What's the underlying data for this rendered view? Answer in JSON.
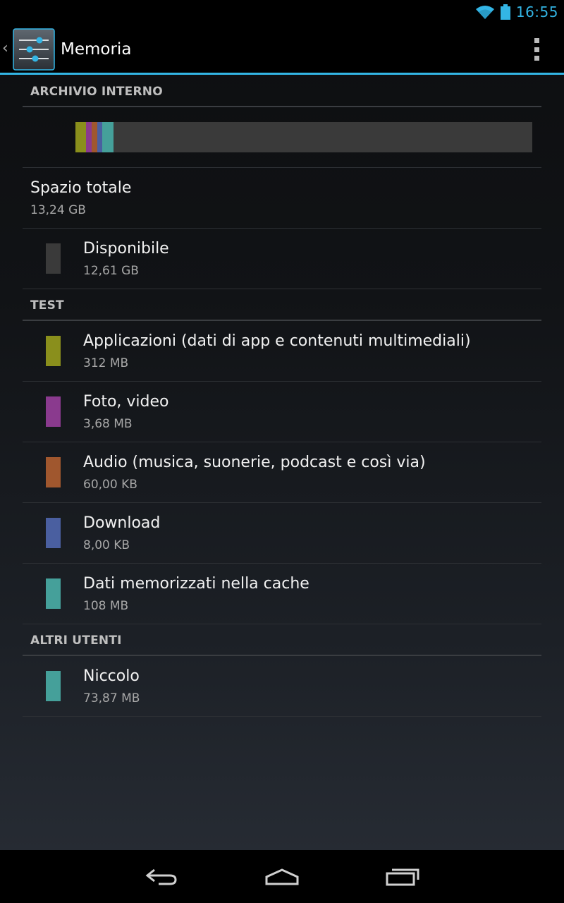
{
  "status_bar": {
    "time": "16:55",
    "icons": [
      "wifi-icon",
      "battery-icon"
    ]
  },
  "action_bar": {
    "title": "Memoria",
    "app_icon": "settings-sliders-icon",
    "overflow_icon": "overflow-menu-icon"
  },
  "colors": {
    "accent": "#33b5e5",
    "available": "#3a3a3a",
    "apps": "#8a8f1c",
    "photos": "#8a3a8e",
    "audio": "#a0572e",
    "downloads": "#4a5fa0",
    "cache": "#45a09a",
    "other_users": "#45a09a"
  },
  "internal_storage": {
    "header": "ARCHIVIO INTERNO",
    "total": {
      "label": "Spazio totale",
      "value": "13,24 GB"
    },
    "available": {
      "label": "Disponibile",
      "value": "12,61 GB"
    }
  },
  "test_section": {
    "header": "TEST",
    "items": [
      {
        "label": "Applicazioni (dati di app e contenuti multimediali)",
        "value": "312 MB",
        "color": "#8a8f1c"
      },
      {
        "label": "Foto, video",
        "value": "3,68 MB",
        "color": "#8a3a8e"
      },
      {
        "label": "Audio (musica, suonerie, podcast e così via)",
        "value": "60,00 KB",
        "color": "#a0572e"
      },
      {
        "label": "Download",
        "value": "8,00 KB",
        "color": "#4a5fa0"
      },
      {
        "label": "Dati memorizzati nella cache",
        "value": "108 MB",
        "color": "#45a09a"
      }
    ]
  },
  "other_users_section": {
    "header": "ALTRI UTENTI",
    "items": [
      {
        "label": "Niccolo",
        "value": "73,87 MB",
        "color": "#45a09a"
      }
    ]
  },
  "nav_bar": {
    "buttons": [
      "back-icon",
      "home-icon",
      "recent-apps-icon"
    ]
  }
}
